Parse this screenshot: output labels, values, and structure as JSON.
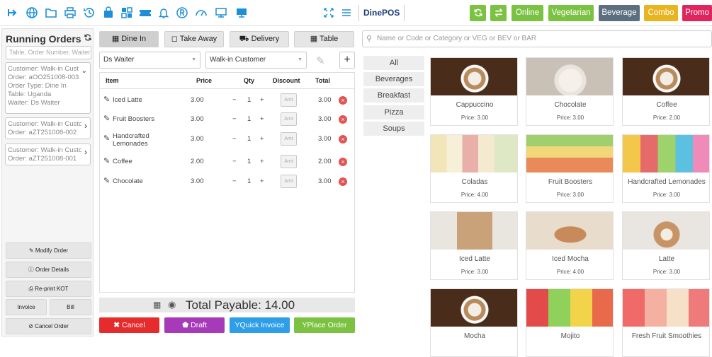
{
  "topbar": {
    "brand": "DinePOS",
    "buttons": {
      "online": "Online",
      "vegetarian": "Vegetarian",
      "beverage": "Beverage",
      "combo": "Combo",
      "promo": "Promo"
    },
    "colors": {
      "icon": "#1e8ed8",
      "green": "#7cc242",
      "beverage": "#5b6f7f",
      "combo": "#e8b520",
      "promo": "#e0245e"
    }
  },
  "running_orders": {
    "title": "Running Orders",
    "search_placeholder": "Table, Order Number, Waiter",
    "orders": [
      {
        "line1": "Customer: Walk-in Customer",
        "line2": "Order: aOO251008-003",
        "line3": "Order Type: Dine In",
        "line4": "Table: Uganda",
        "line5": "Waiter: Ds Waiter"
      },
      {
        "line1": "Customer: Walk-in Customer",
        "line2": "Order: aZT251008-002"
      },
      {
        "line1": "Customer: Walk-in Customer",
        "line2": "Order: aZT251008-001"
      }
    ],
    "buttons": {
      "modify": "Modify Order",
      "details": "Order Details",
      "reprint": "Re-print KOT",
      "invoice": "Invoice",
      "bill": "Bill",
      "cancel": "Cancel Order"
    }
  },
  "order_panel": {
    "tabs": {
      "dine_in": "Dine In",
      "take_away": "Take Away",
      "delivery": "Delivery",
      "table": "Table"
    },
    "waiter": "Ds Waiter",
    "customer": "Walk-in Customer",
    "headers": {
      "item": "Item",
      "price": "Price",
      "qty": "Qty",
      "discount": "Discount",
      "total": "Total"
    },
    "discount_placeholder": "Amt",
    "items": [
      {
        "name": "Iced Latte",
        "price": "3.00",
        "qty": "1",
        "total": "3.00"
      },
      {
        "name": "Fruit Boosters",
        "price": "3.00",
        "qty": "1",
        "total": "3.00"
      },
      {
        "name": "Handcrafted Lemonades",
        "price": "3.00",
        "qty": "1",
        "total": "3.00"
      },
      {
        "name": "Coffee",
        "price": "2.00",
        "qty": "1",
        "total": "2.00"
      },
      {
        "name": "Chocolate",
        "price": "3.00",
        "qty": "1",
        "total": "3.00"
      }
    ],
    "total_label": "Total Payable: 14.00",
    "actions": {
      "cancel": "Cancel",
      "draft": "Draft",
      "quick_invoice": "Quick Invoice",
      "place_order": "Place Order"
    },
    "action_colors": {
      "cancel": "#e52b2b",
      "draft": "#a73ab8",
      "quick_invoice": "#2e9ee8",
      "place_order": "#7cc242"
    }
  },
  "menu": {
    "search_placeholder": "Name or Code or Category or VEG or BEV or BAR",
    "categories": [
      "All",
      "Beverages",
      "Breakfast",
      "Pizza",
      "Soups"
    ],
    "products": [
      {
        "name": "Cappuccino",
        "price": "Price: 3.00"
      },
      {
        "name": "Chocolate",
        "price": "Price: 3.00"
      },
      {
        "name": "Coffee",
        "price": "Price: 2.00"
      },
      {
        "name": "Coladas",
        "price": "Price: 4.00"
      },
      {
        "name": "Fruit Boosters",
        "price": "Price: 3.00"
      },
      {
        "name": "Handcrafted Lemonades",
        "price": "Price: 3.00"
      },
      {
        "name": "Iced Latte",
        "price": "Price: 3.00"
      },
      {
        "name": "Iced Mocha",
        "price": "Price: 4.00"
      },
      {
        "name": "Latte",
        "price": "Price: 3.00"
      },
      {
        "name": "Mocha",
        "price": ""
      },
      {
        "name": "Mojito",
        "price": ""
      },
      {
        "name": "Fresh Fruit Smoothies",
        "price": ""
      }
    ]
  }
}
